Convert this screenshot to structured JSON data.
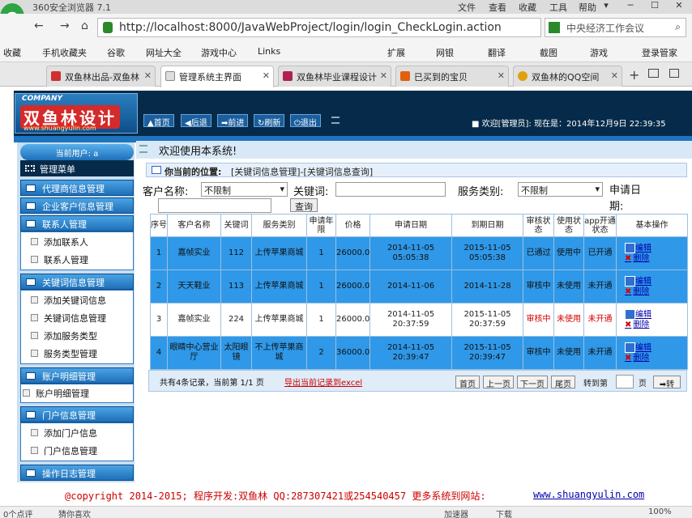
{
  "browser": {
    "title": "360安全浏览器 7.1",
    "menu": [
      "文件",
      "查看",
      "收藏",
      "工具",
      "帮助"
    ],
    "window_controls": [
      "▾",
      "─",
      "☐",
      "✕"
    ],
    "url": "http://localhost:8000/JavaWebProject/login/login_CheckLogin.action",
    "search_text": "中央经济工作会议",
    "nav": {
      "back": "←",
      "forward": "→",
      "refresh": "⌂"
    }
  },
  "favorites": [
    "收藏",
    "手机收藏夹",
    "谷歌",
    "网址大全",
    "游戏中心",
    "Links",
    "扩展",
    "网银",
    "翻译",
    "截图",
    "游戏",
    "登录管家"
  ],
  "tabs": [
    {
      "label": "双鱼林出品-双鱼林",
      "color": "#d03030",
      "active": false
    },
    {
      "label": "管理系统主界面",
      "color": "#888888",
      "active": true
    },
    {
      "label": "双鱼林毕业课程设计",
      "color": "#b02050",
      "active": false
    },
    {
      "label": "已买到的宝贝",
      "color": "#e06010",
      "active": false
    },
    {
      "label": "双鱼林的QQ空间",
      "color": "#e0a010",
      "active": false
    }
  ],
  "header": {
    "logo_company": "COMPANY",
    "logo_title": "双鱼林设计",
    "logo_url": "www.shuangyulin.com",
    "buttons": [
      "首页",
      "后退",
      "前进",
      "刷新",
      "退出"
    ],
    "welcome": "■ 欢迎[管理员]:   现在是：2014年12月9日 22:39:35"
  },
  "sidebar": {
    "current_user": "当前用户: a",
    "menu_title": "管理菜单",
    "groups": [
      {
        "title": "代理商信息管理",
        "items": []
      },
      {
        "title": "企业客户信息管理",
        "items": []
      },
      {
        "title": "联系人管理",
        "items": [
          "添加联系人",
          "联系人管理"
        ]
      },
      {
        "title": "关键词信息管理",
        "items": [
          "添加关键词信息",
          "关键词信息管理",
          "添加服务类型",
          "服务类型管理"
        ]
      },
      {
        "title": "账户明细管理",
        "items": [
          "账户明细管理"
        ]
      },
      {
        "title": "门户信息管理",
        "items": [
          "添加门户信息",
          "门户信息管理"
        ]
      },
      {
        "title": "操作日志管理",
        "items": []
      }
    ]
  },
  "main": {
    "welcome": "欢迎使用本系统!",
    "location_label": "你当前的位置:",
    "location": "[关键词信息管理]-[关键词信息查询]",
    "filter": {
      "customer_label": "客户名称:",
      "customer_value": "不限制",
      "keyword_label": "关键词:",
      "keyword_value": "",
      "service_label": "服务类别:",
      "service_value": "不限制",
      "date_label": "申请日期:",
      "date_value": "",
      "query_button": "查询"
    },
    "table": {
      "headers": [
        "序号",
        "客户名称",
        "关键词",
        "服务类别",
        "申请年限",
        "价格",
        "申请日期",
        "到期日期",
        "审核状态",
        "使用状态",
        "app开通状态",
        "基本操作"
      ],
      "rows": [
        {
          "no": "1",
          "customer": "嘉帧实业",
          "keyword": "112",
          "service": "上传苹果商城",
          "years": "1",
          "price": "26000.0",
          "apply": "2014-11-05 05:05:38",
          "expire": "2015-11-05 05:05:38",
          "audit": "已通过",
          "use": "使用中",
          "app": "已开通",
          "style": "blue",
          "audit_c": "cg",
          "use_c": "cg",
          "app_c": "cg"
        },
        {
          "no": "2",
          "customer": "天天鞋业",
          "keyword": "113",
          "service": "上传苹果商城",
          "years": "1",
          "price": "26000.0",
          "apply": "2014-11-06",
          "expire": "2014-11-28",
          "audit": "审核中",
          "use": "未使用",
          "app": "未开通",
          "style": "blue",
          "audit_c": "cr",
          "use_c": "cr",
          "app_c": "cr"
        },
        {
          "no": "3",
          "customer": "嘉帧实业",
          "keyword": "224",
          "service": "上传苹果商城",
          "years": "1",
          "price": "26000.0",
          "apply": "2014-11-05 20:37:59",
          "expire": "2015-11-05 20:37:59",
          "audit": "审核中",
          "use": "未使用",
          "app": "未开通",
          "style": "white",
          "audit_c": "cr",
          "use_c": "cr",
          "app_c": "cr"
        },
        {
          "no": "4",
          "customer": "眼睛中心营业厅",
          "keyword": "太阳眼镜",
          "service": "不上传苹果商城",
          "years": "2",
          "price": "36000.0",
          "apply": "2014-11-05 20:39:47",
          "expire": "2015-11-05 20:39:47",
          "audit": "审核中",
          "use": "未使用",
          "app": "未开通",
          "style": "blue",
          "audit_c": "cr",
          "use_c": "cr",
          "app_c": "cr"
        }
      ],
      "edit_label": "编辑",
      "delete_label": "删除"
    },
    "pager": {
      "summary": "共有4条记录，当前第 1/1 页",
      "export": "导出当前记录到excel",
      "first": "首页",
      "prev": "上一页",
      "next": "下一页",
      "last": "尾页",
      "goto": "转到第",
      "page_unit": "页",
      "go": "➡转"
    }
  },
  "footer": {
    "copyright": "@copyright 2014-2015; 程序开发:双鱼林  QQ:287307421或254540457  更多系统到网站:",
    "link": "www.shuangyulin.com"
  },
  "statusbar": [
    "0个点评",
    "猜你喜欢",
    "加速器",
    "下载",
    "100%"
  ]
}
